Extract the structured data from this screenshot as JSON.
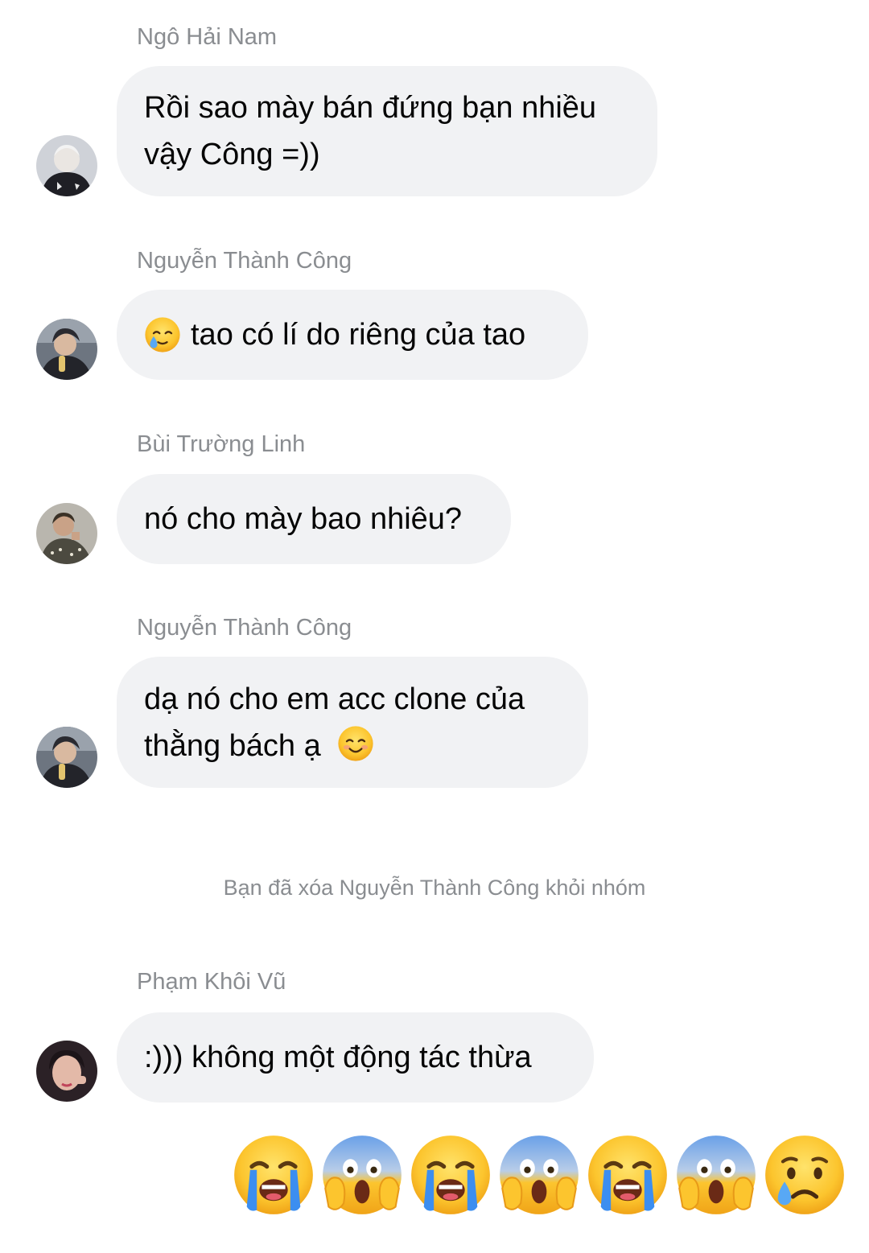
{
  "messages": [
    {
      "sender": "Ngô Hải Nam",
      "lines": [
        "Rồi sao mày bán đứng bạn nhiều",
        "vậy Công =))"
      ]
    },
    {
      "sender": "Nguyễn Thành Công",
      "text": "tao có lí do riêng của tao",
      "leading_emoji": "crying-tear-face"
    },
    {
      "sender": "Bùi Trường Linh",
      "text": "nó cho mày bao nhiêu?"
    },
    {
      "sender": "Nguyễn Thành Công",
      "lines": [
        "dạ nó cho em acc clone của",
        "thằng bách ạ"
      ],
      "trailing_emoji": "smiling-blush-face"
    },
    {
      "sender": "Phạm Khôi Vũ",
      "text": ":))) không một động tác thừa"
    }
  ],
  "system_notice": "Bạn đã xóa Nguyễn Thành Công khỏi nhóm",
  "reaction_emojis": [
    "loudly-crying-face",
    "screaming-face",
    "loudly-crying-face",
    "screaming-face",
    "loudly-crying-face",
    "screaming-face",
    "crying-face"
  ],
  "colors": {
    "bubble": "#f1f2f4",
    "sender_text": "#8a8d91",
    "message_text": "#050505",
    "emoji_yellow": "#fbbf24",
    "emoji_blue": "#3b82f6"
  }
}
